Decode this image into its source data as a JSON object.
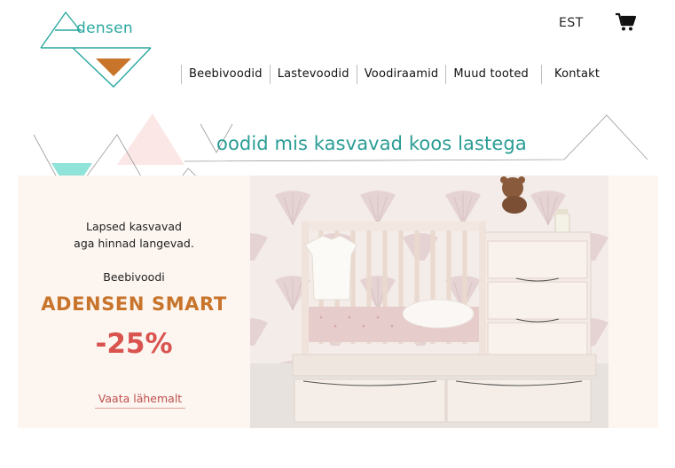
{
  "brand": {
    "logo_text": "densen",
    "colors": {
      "teal": "#2ba8a0",
      "orange": "#c8742b",
      "red": "#d9534f",
      "hero_bg": "#fcf5f0"
    }
  },
  "header": {
    "language": "EST",
    "cart_icon": "cart-icon"
  },
  "nav": {
    "items": [
      "Beebivoodid",
      "Lastevoodid",
      "Voodiraamid",
      "Muud tooted",
      "Kontakt"
    ]
  },
  "tagline": "oodid mis kasvavad koos lastega",
  "promo": {
    "line1": "Lapsed kasvavad",
    "line2": "aga hinnad langevad.",
    "category": "Beebivoodi",
    "product": "ADENSEN SMART",
    "discount": "-25%",
    "link": "Vaata lähemalt"
  },
  "hero_image": {
    "subject": "convertible white crib with drawers, teddy bear and lamp"
  }
}
